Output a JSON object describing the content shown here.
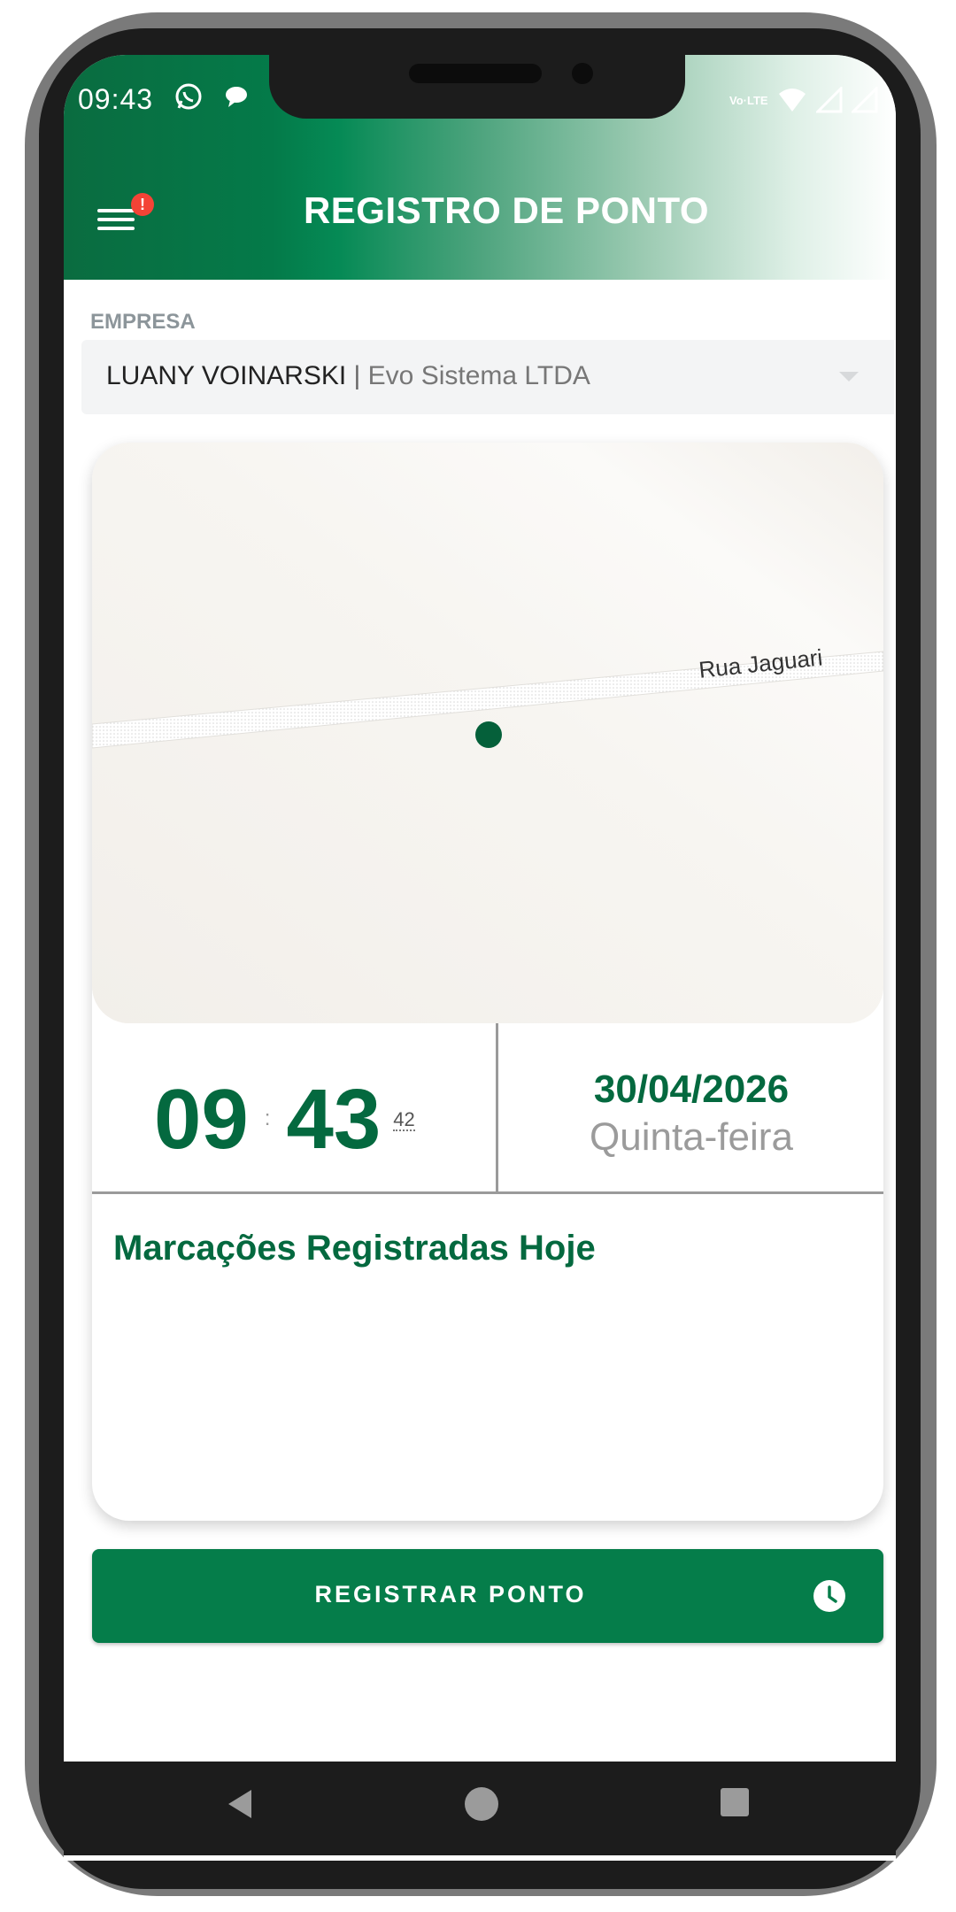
{
  "status_bar": {
    "time": "09:43",
    "volte_text": "Vo·LTE"
  },
  "header": {
    "title": "REGISTRO DE PONTO",
    "menu_badge": "!"
  },
  "empresa": {
    "label": "EMPRESA",
    "employee": "LUANY VOINARSKI",
    "separator": " | ",
    "company": "Evo Sistema LTDA"
  },
  "map": {
    "street_label": "Rua Jaguari"
  },
  "clock": {
    "hours": "09",
    "minutes": "43",
    "seconds": "42",
    "date": "30/04/2026",
    "weekday": "Quinta-feira"
  },
  "marks": {
    "title": "Marcações Registradas Hoje",
    "items": []
  },
  "register_button": {
    "label": "REGISTRAR PONTO"
  },
  "colors": {
    "primary_green": "#057d4a",
    "dark_green_text": "#04693f",
    "badge_red": "#f44336"
  }
}
